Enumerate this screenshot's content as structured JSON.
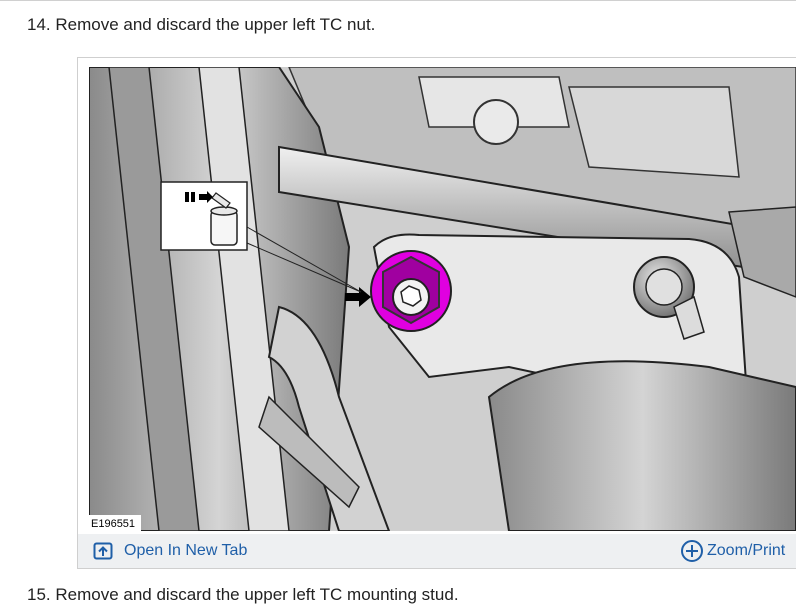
{
  "steps": {
    "step_14": "14. Remove and discard the upper left TC nut.",
    "step_15": "15. Remove and discard the upper left TC mounting stud."
  },
  "figure": {
    "code": "E196551",
    "highlight_color": "#e000e0"
  },
  "toolbar": {
    "open_tab_label": "Open In New Tab",
    "zoom_label": "Zoom/Print",
    "link_color": "#1f5fa8"
  },
  "icons": {
    "open_tab": "open-in-new-tab-icon",
    "zoom": "zoom-plus-icon",
    "discard": "discard-bin-icon"
  }
}
